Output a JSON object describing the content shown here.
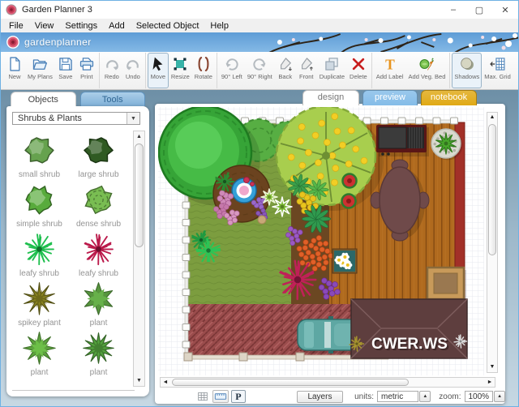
{
  "window": {
    "title": "Garden Planner 3",
    "controls": {
      "minimize": "–",
      "maximize": "▢",
      "close": "✕"
    }
  },
  "menu": {
    "items": [
      "File",
      "View",
      "Settings",
      "Add",
      "Selected Object",
      "Help"
    ]
  },
  "banner": {
    "logo_text": "gardenplanner"
  },
  "toolbar": {
    "groups": [
      {
        "tools": [
          {
            "name": "new",
            "label": "New",
            "icon": "page"
          },
          {
            "name": "my-plans",
            "label": "My Plans",
            "icon": "folder"
          },
          {
            "name": "save",
            "label": "Save",
            "icon": "save"
          },
          {
            "name": "print",
            "label": "Print",
            "icon": "print"
          }
        ]
      },
      {
        "tools": [
          {
            "name": "redo",
            "label": "Redo",
            "icon": "redo"
          },
          {
            "name": "undo",
            "label": "Undo",
            "icon": "undo"
          }
        ]
      },
      {
        "tools": [
          {
            "name": "move",
            "label": "Move",
            "icon": "cursor",
            "selected": true
          },
          {
            "name": "resize",
            "label": "Resize",
            "icon": "resize"
          },
          {
            "name": "rotate",
            "label": "Rotate",
            "icon": "rotate"
          }
        ]
      },
      {
        "tools": [
          {
            "name": "rotate-90-left",
            "label": "90° Left",
            "icon": "arcl"
          },
          {
            "name": "rotate-90-right",
            "label": "90° Right",
            "icon": "arcr"
          },
          {
            "name": "back",
            "label": "Back",
            "icon": "penb"
          },
          {
            "name": "front",
            "label": "Front",
            "icon": "penf"
          },
          {
            "name": "duplicate",
            "label": "Duplicate",
            "icon": "dup"
          },
          {
            "name": "delete",
            "label": "Delete",
            "icon": "del"
          }
        ]
      },
      {
        "tools": [
          {
            "name": "add-label",
            "label": "Add Label",
            "icon": "text"
          },
          {
            "name": "add-veg-bed",
            "label": "Add Veg. Bed",
            "icon": "veg"
          }
        ]
      },
      {
        "tools": [
          {
            "name": "shadows",
            "label": "Shadows",
            "icon": "shadow",
            "selected": true
          },
          {
            "name": "max-grid",
            "label": "Max. Grid",
            "icon": "grid"
          }
        ]
      }
    ]
  },
  "sidebar": {
    "tabs": [
      {
        "label": "Objects",
        "active": true
      },
      {
        "label": "Tools",
        "active": false
      }
    ],
    "category_select": {
      "value": "Shrubs & Plants"
    },
    "plants": [
      {
        "label": "small shrub",
        "shape": "blob",
        "color": "#66a24e"
      },
      {
        "label": "large shrub",
        "shape": "blob",
        "color": "#2f5a22"
      },
      {
        "label": "simple shrub",
        "shape": "blob2",
        "color": "#58ab3c"
      },
      {
        "label": "dense shrub",
        "shape": "dense",
        "color": "#79bd52"
      },
      {
        "label": "leafy shrub",
        "shape": "spiky",
        "color": "#1fbf4e"
      },
      {
        "label": "leafy shrub",
        "shape": "spiky",
        "color": "#bb1a4b"
      },
      {
        "label": "spikey plant",
        "shape": "star10",
        "color": "#8a8420"
      },
      {
        "label": "plant",
        "shape": "star6",
        "color": "#67b14a"
      },
      {
        "label": "plant",
        "shape": "star8",
        "color": "#6dbf48"
      },
      {
        "label": "plant",
        "shape": "star12",
        "color": "#54a23e"
      }
    ]
  },
  "canvas": {
    "tabs": [
      {
        "label": "design",
        "active": true,
        "color": "#ffffff"
      },
      {
        "label": "preview",
        "active": false,
        "color": "#84bce8"
      },
      {
        "label": "notebook",
        "active": false,
        "color": "#e0a915"
      }
    ],
    "watermark": "CWER.WS"
  },
  "statusbar": {
    "p_button": "P",
    "layers_label": "Layers",
    "units_label": "units:",
    "units_value": "metric",
    "zoom_label": "zoom:",
    "zoom_value": "100%"
  }
}
